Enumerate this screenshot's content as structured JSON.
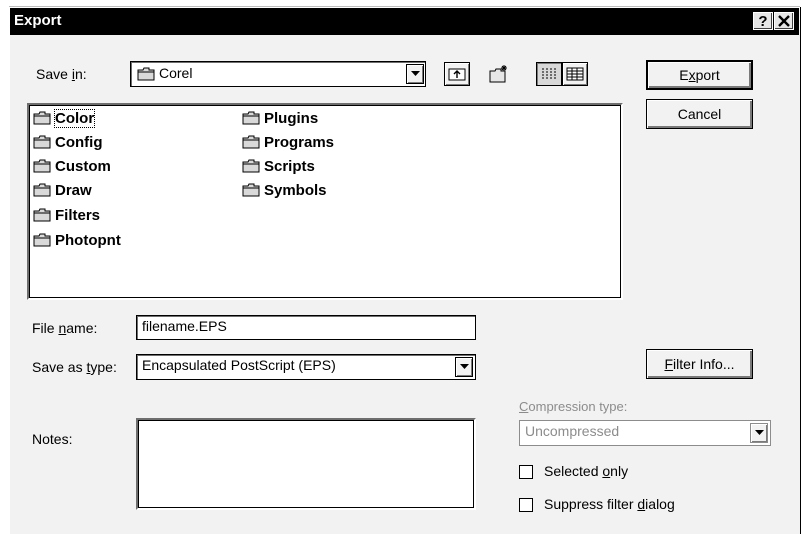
{
  "window": {
    "title": "Export",
    "help_button": "?",
    "close_button": "✕"
  },
  "save_in": {
    "label_pre": "Save ",
    "label_key": "i",
    "label_post": "n:",
    "value": "Corel"
  },
  "folders": [
    "Color",
    "Config",
    "Custom",
    "Draw",
    "Filters",
    "Photopnt",
    "Plugins",
    "Programs",
    "Scripts",
    "Symbols"
  ],
  "buttons": {
    "export_key": "x",
    "export_pre": "E",
    "export_post": "port",
    "cancel": "Cancel",
    "filter_info_key": "F",
    "filter_info_post": "ilter Info..."
  },
  "file_name": {
    "label_pre": "File ",
    "label_key": "n",
    "label_post": "ame:",
    "value": "filename.EPS"
  },
  "save_as_type": {
    "label_pre": "Save as ",
    "label_key": "t",
    "label_post": "ype:",
    "value": "Encapsulated PostScript (EPS)"
  },
  "notes": {
    "label": "Notes:"
  },
  "compression": {
    "label_key": "C",
    "label_post": "ompression type:",
    "value": "Uncompressed"
  },
  "selected_only": {
    "label_pre": "Selected ",
    "label_key": "o",
    "label_post": "nly",
    "checked": false
  },
  "suppress_filter": {
    "label_pre": "Suppress filter ",
    "label_key": "d",
    "label_post": "ialog",
    "checked": false
  }
}
